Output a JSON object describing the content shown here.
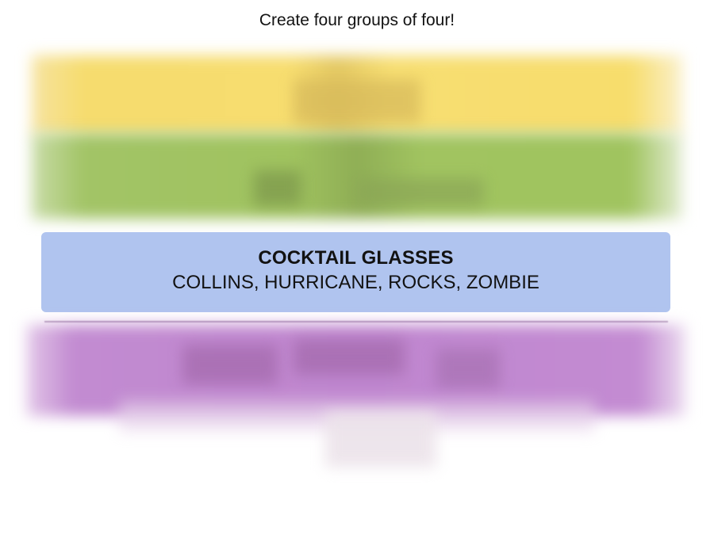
{
  "header": {
    "instructions": "Create four groups of four!"
  },
  "groups": [
    {
      "state": "hidden",
      "color_hex": "#f9df6d",
      "label": ""
    },
    {
      "state": "hidden",
      "color_hex": "#a0c35a",
      "label": ""
    },
    {
      "state": "solved",
      "color_hex": "#b0c4ef",
      "title": "COCKTAIL GLASSES",
      "members": "COLLINS, HURRICANE, ROCKS, ZOMBIE"
    },
    {
      "state": "hidden",
      "color_hex": "#ba81c5",
      "label": ""
    }
  ]
}
